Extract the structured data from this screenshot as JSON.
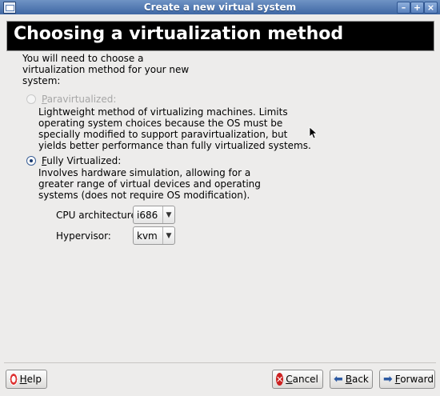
{
  "window": {
    "title": "Create a new virtual system",
    "minimize_label": "–",
    "maximize_label": "+",
    "close_label": "×"
  },
  "header": {
    "title": "Choosing a virtualization method"
  },
  "intro_text_lines": [
    "You will need to choose a",
    "virtualization method for your new",
    "system:"
  ],
  "options": {
    "para": {
      "mnemonic": "P",
      "label_rest": "aravirtualized:",
      "selected": false,
      "enabled": false,
      "desc_lines": [
        "Lightweight method of virtualizing machines. Limits",
        "operating system choices because the OS must be",
        "specially modified to support paravirtualization, but",
        "yields better performance than fully virtualized systems."
      ]
    },
    "full": {
      "mnemonic": "F",
      "label_rest": "ully Virtualized:",
      "selected": true,
      "enabled": true,
      "desc_lines": [
        "Involves hardware simulation, allowing for a",
        "greater range of virtual devices and operating",
        "systems (does not require OS modification)."
      ]
    }
  },
  "fields": {
    "cpu": {
      "label": "CPU architecture:",
      "value": "i686"
    },
    "hypervisor": {
      "label": "Hypervisor:",
      "value": "kvm"
    }
  },
  "buttons": {
    "help": {
      "mnemonic": "H",
      "rest": "elp"
    },
    "cancel": {
      "mnemonic": "C",
      "rest": "ancel"
    },
    "back": {
      "mnemonic": "B",
      "rest": "ack"
    },
    "forward": {
      "mnemonic": "F",
      "rest": "orward"
    }
  },
  "icons": {
    "window_menu": "window-menu-icon",
    "help": "lifebuoy-icon",
    "cancel": "cancel-icon",
    "back": "back-arrow-icon",
    "forward": "forward-arrow-icon",
    "combo_arrow": "chevron-down-icon"
  },
  "colors": {
    "titlebar": "#4a72ad",
    "banner": "#000000",
    "window_bg": "#edeceb"
  }
}
